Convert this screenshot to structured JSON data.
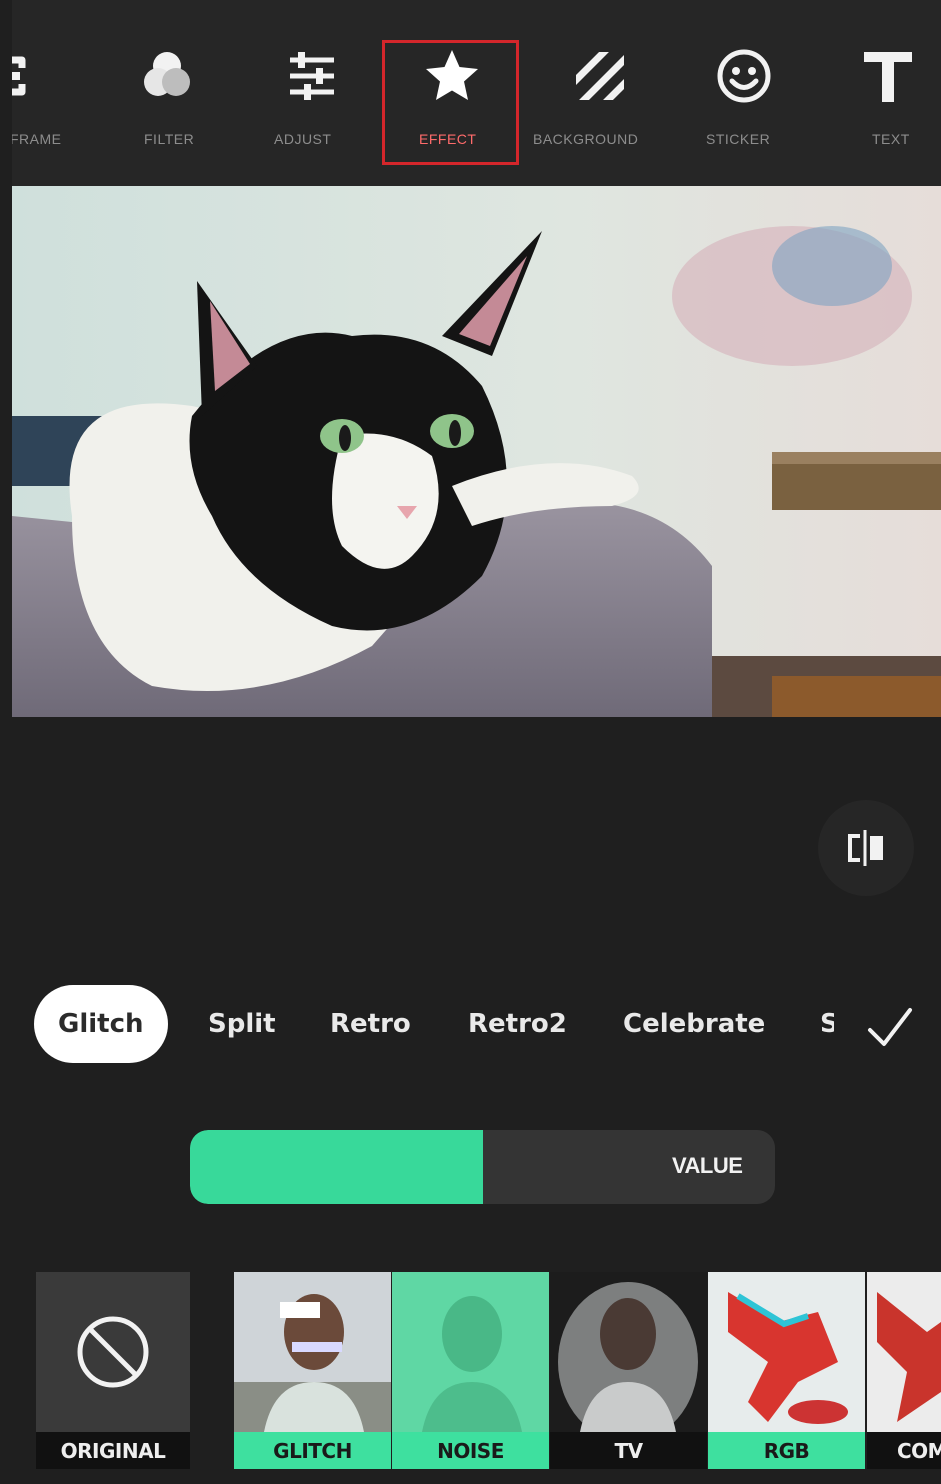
{
  "toolbar": {
    "tools": [
      {
        "label": "FRAME",
        "icon": "frame-icon"
      },
      {
        "label": "FILTER",
        "icon": "filter-icon"
      },
      {
        "label": "ADJUST",
        "icon": "adjust-sliders-icon"
      },
      {
        "label": "EFFECT",
        "icon": "star-icon",
        "active": true
      },
      {
        "label": "BACKGROUND",
        "icon": "stripes-icon"
      },
      {
        "label": "STICKER",
        "icon": "smiley-icon"
      },
      {
        "label": "TEXT",
        "icon": "text-t-icon"
      }
    ],
    "active_color": "#d4262b"
  },
  "photo": {
    "subject": "cat-photo"
  },
  "categories": {
    "items": [
      "Glitch",
      "Split",
      "Retro",
      "Retro2",
      "Celebrate",
      "S"
    ],
    "selected": "Glitch"
  },
  "slider": {
    "label": "VALUE",
    "value": 0.5,
    "fill_color": "#38d99a"
  },
  "effects": {
    "original_label": "ORIGINAL",
    "items": [
      {
        "label": "GLITCH"
      },
      {
        "label": "NOISE"
      },
      {
        "label": "TV"
      },
      {
        "label": "RGB"
      },
      {
        "label": "COM"
      }
    ],
    "accent": "#3ee09f"
  }
}
